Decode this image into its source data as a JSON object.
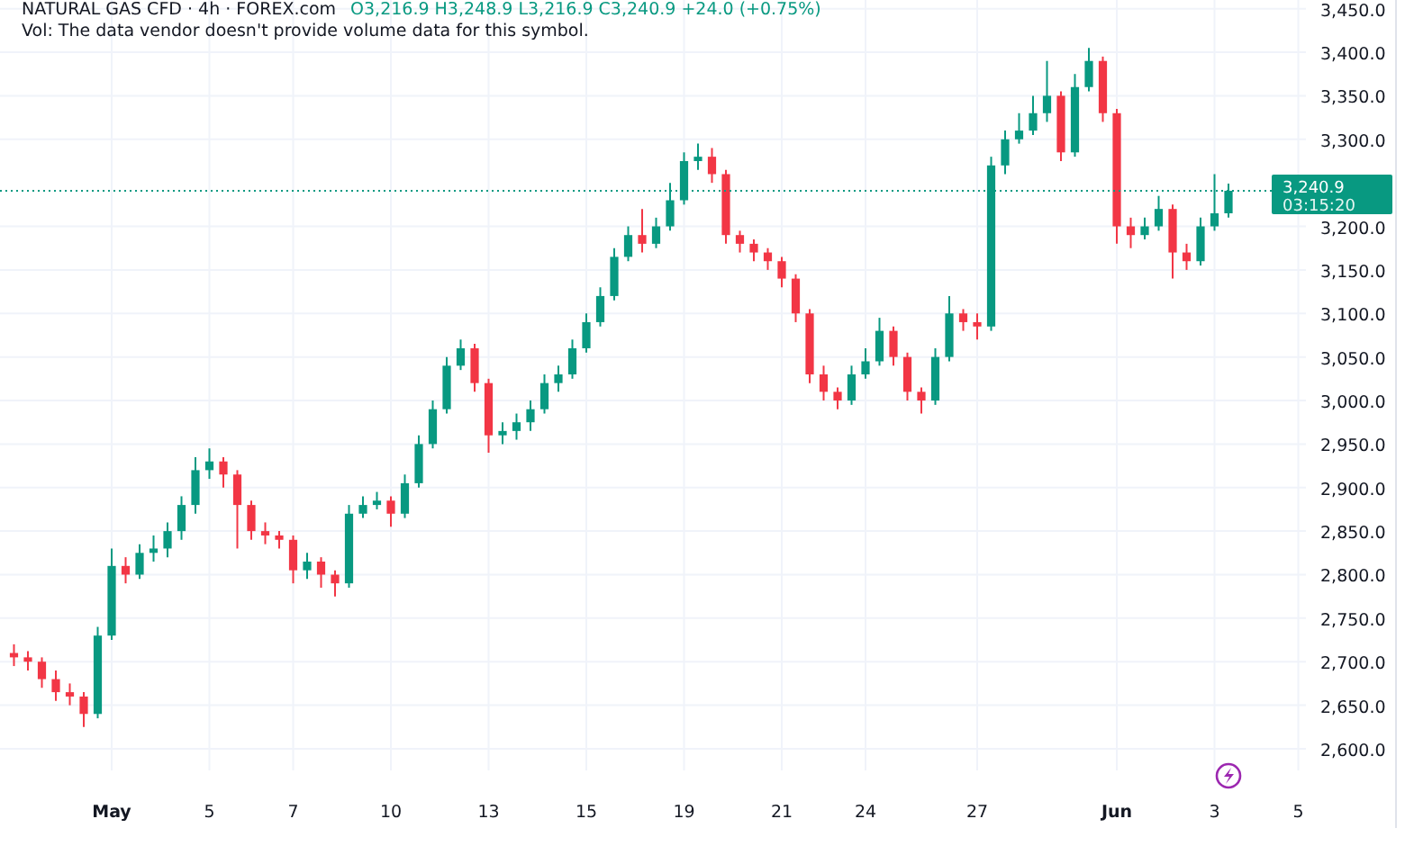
{
  "legend": {
    "title": "NATURAL GAS CFD · 4h · FOREX.com",
    "ohlc": "O3,216.9 H3,248.9 L3,216.9 C3,240.9 +24.0 (+0.75%)",
    "volume_note": "Vol: The data vendor doesn't provide volume data for this symbol."
  },
  "chart": {
    "countdown": "03:15:20",
    "chart_data": {
      "type": "candlestick",
      "grid": true,
      "ylim": [
        2509,
        3460
      ],
      "yticks": [
        {
          "value": 2600,
          "label": "2,600.0"
        },
        {
          "value": 2650,
          "label": "2,650.0"
        },
        {
          "value": 2700,
          "label": "2,700.0"
        },
        {
          "value": 2750,
          "label": "2,750.0"
        },
        {
          "value": 2800,
          "label": "2,800.0"
        },
        {
          "value": 2850,
          "label": "2,850.0"
        },
        {
          "value": 2900,
          "label": "2,900.0"
        },
        {
          "value": 2950,
          "label": "2,950.0"
        },
        {
          "value": 3000,
          "label": "3,000.0"
        },
        {
          "value": 3050,
          "label": "3,050.0"
        },
        {
          "value": 3100,
          "label": "3,100.0"
        },
        {
          "value": 3150,
          "label": "3,150.0"
        },
        {
          "value": 3200,
          "label": "3,200.0"
        },
        {
          "value": 3300,
          "label": "3,300.0"
        },
        {
          "value": 3350,
          "label": "3,350.0"
        },
        {
          "value": 3400,
          "label": "3,400.0"
        },
        {
          "value": 3450,
          "label": "3,450.0"
        }
      ],
      "categories": [
        null,
        null,
        null,
        null,
        null,
        null,
        null,
        "May",
        null,
        null,
        null,
        null,
        null,
        null,
        "5",
        null,
        null,
        null,
        null,
        null,
        "7",
        null,
        null,
        null,
        null,
        null,
        null,
        "10",
        null,
        null,
        null,
        null,
        null,
        null,
        "13",
        null,
        null,
        null,
        null,
        null,
        null,
        "15",
        null,
        null,
        null,
        null,
        null,
        null,
        "19",
        null,
        null,
        null,
        null,
        null,
        null,
        "21",
        null,
        null,
        null,
        null,
        null,
        "24",
        null,
        null,
        null,
        null,
        null,
        null,
        null,
        "27",
        null,
        null,
        null,
        null,
        null,
        null,
        null,
        null,
        null,
        "Jun",
        null,
        null,
        null,
        null,
        null,
        null,
        "3",
        null,
        null,
        null,
        null,
        null,
        "5",
        null,
        null,
        null,
        null,
        null,
        null
      ],
      "ohlc": [
        [
          2710,
          2720,
          2695,
          2705
        ],
        [
          2705,
          2712,
          2690,
          2700
        ],
        [
          2700,
          2705,
          2670,
          2680
        ],
        [
          2680,
          2690,
          2655,
          2665
        ],
        [
          2665,
          2675,
          2650,
          2660
        ],
        [
          2660,
          2665,
          2625,
          2640
        ],
        [
          2640,
          2740,
          2635,
          2730
        ],
        [
          2730,
          2830,
          2725,
          2810
        ],
        [
          2810,
          2820,
          2790,
          2800
        ],
        [
          2800,
          2835,
          2795,
          2825
        ],
        [
          2825,
          2845,
          2815,
          2830
        ],
        [
          2830,
          2860,
          2820,
          2850
        ],
        [
          2850,
          2890,
          2840,
          2880
        ],
        [
          2880,
          2935,
          2870,
          2920
        ],
        [
          2920,
          2945,
          2910,
          2930
        ],
        [
          2930,
          2935,
          2900,
          2915
        ],
        [
          2915,
          2920,
          2830,
          2880
        ],
        [
          2880,
          2885,
          2840,
          2850
        ],
        [
          2850,
          2860,
          2835,
          2845
        ],
        [
          2845,
          2850,
          2830,
          2840
        ],
        [
          2840,
          2845,
          2790,
          2805
        ],
        [
          2805,
          2825,
          2795,
          2815
        ],
        [
          2815,
          2820,
          2785,
          2800
        ],
        [
          2800,
          2805,
          2775,
          2790
        ],
        [
          2790,
          2880,
          2785,
          2870
        ],
        [
          2870,
          2890,
          2865,
          2880
        ],
        [
          2880,
          2895,
          2875,
          2885
        ],
        [
          2885,
          2890,
          2855,
          2870
        ],
        [
          2870,
          2915,
          2865,
          2905
        ],
        [
          2905,
          2960,
          2900,
          2950
        ],
        [
          2950,
          3000,
          2945,
          2990
        ],
        [
          2990,
          3050,
          2985,
          3040
        ],
        [
          3040,
          3070,
          3035,
          3060
        ],
        [
          3060,
          3065,
          3010,
          3020
        ],
        [
          3020,
          3025,
          2940,
          2960
        ],
        [
          2960,
          2975,
          2950,
          2965
        ],
        [
          2965,
          2985,
          2955,
          2975
        ],
        [
          2975,
          3000,
          2965,
          2990
        ],
        [
          2990,
          3030,
          2985,
          3020
        ],
        [
          3020,
          3040,
          3010,
          3030
        ],
        [
          3030,
          3070,
          3025,
          3060
        ],
        [
          3060,
          3100,
          3055,
          3090
        ],
        [
          3090,
          3130,
          3085,
          3120
        ],
        [
          3120,
          3175,
          3115,
          3165
        ],
        [
          3165,
          3200,
          3160,
          3190
        ],
        [
          3190,
          3220,
          3170,
          3180
        ],
        [
          3180,
          3210,
          3175,
          3200
        ],
        [
          3200,
          3250,
          3195,
          3230
        ],
        [
          3230,
          3285,
          3225,
          3275
        ],
        [
          3275,
          3295,
          3265,
          3280
        ],
        [
          3280,
          3290,
          3250,
          3260
        ],
        [
          3260,
          3265,
          3180,
          3190
        ],
        [
          3190,
          3195,
          3170,
          3180
        ],
        [
          3180,
          3185,
          3160,
          3170
        ],
        [
          3170,
          3175,
          3150,
          3160
        ],
        [
          3160,
          3165,
          3130,
          3140
        ],
        [
          3140,
          3145,
          3090,
          3100
        ],
        [
          3100,
          3105,
          3020,
          3030
        ],
        [
          3030,
          3040,
          3000,
          3010
        ],
        [
          3010,
          3015,
          2990,
          3000
        ],
        [
          3000,
          3040,
          2995,
          3030
        ],
        [
          3030,
          3060,
          3025,
          3045
        ],
        [
          3045,
          3095,
          3040,
          3080
        ],
        [
          3080,
          3085,
          3040,
          3050
        ],
        [
          3050,
          3055,
          3000,
          3010
        ],
        [
          3010,
          3015,
          2985,
          3000
        ],
        [
          3000,
          3060,
          2995,
          3050
        ],
        [
          3050,
          3120,
          3045,
          3100
        ],
        [
          3100,
          3105,
          3080,
          3090
        ],
        [
          3090,
          3100,
          3070,
          3085
        ],
        [
          3085,
          3280,
          3080,
          3270
        ],
        [
          3270,
          3310,
          3260,
          3300
        ],
        [
          3300,
          3330,
          3295,
          3310
        ],
        [
          3310,
          3350,
          3305,
          3330
        ],
        [
          3330,
          3390,
          3320,
          3350
        ],
        [
          3350,
          3355,
          3275,
          3285
        ],
        [
          3285,
          3375,
          3280,
          3360
        ],
        [
          3360,
          3405,
          3355,
          3390
        ],
        [
          3390,
          3395,
          3320,
          3330
        ],
        [
          3330,
          3335,
          3180,
          3200
        ],
        [
          3200,
          3210,
          3175,
          3190
        ],
        [
          3190,
          3210,
          3185,
          3200
        ],
        [
          3200,
          3235,
          3195,
          3220
        ],
        [
          3220,
          3225,
          3140,
          3170
        ],
        [
          3170,
          3180,
          3150,
          3160
        ],
        [
          3160,
          3210,
          3155,
          3200
        ],
        [
          3200,
          3260,
          3195,
          3215
        ],
        [
          3215,
          3249,
          3210,
          3240.9
        ],
        null,
        null,
        null,
        null,
        null,
        null,
        null,
        null,
        null,
        null,
        null
      ],
      "ref_lines": [
        {
          "axis": "y",
          "value": 3240.9,
          "label": "3,240.9"
        }
      ]
    }
  }
}
